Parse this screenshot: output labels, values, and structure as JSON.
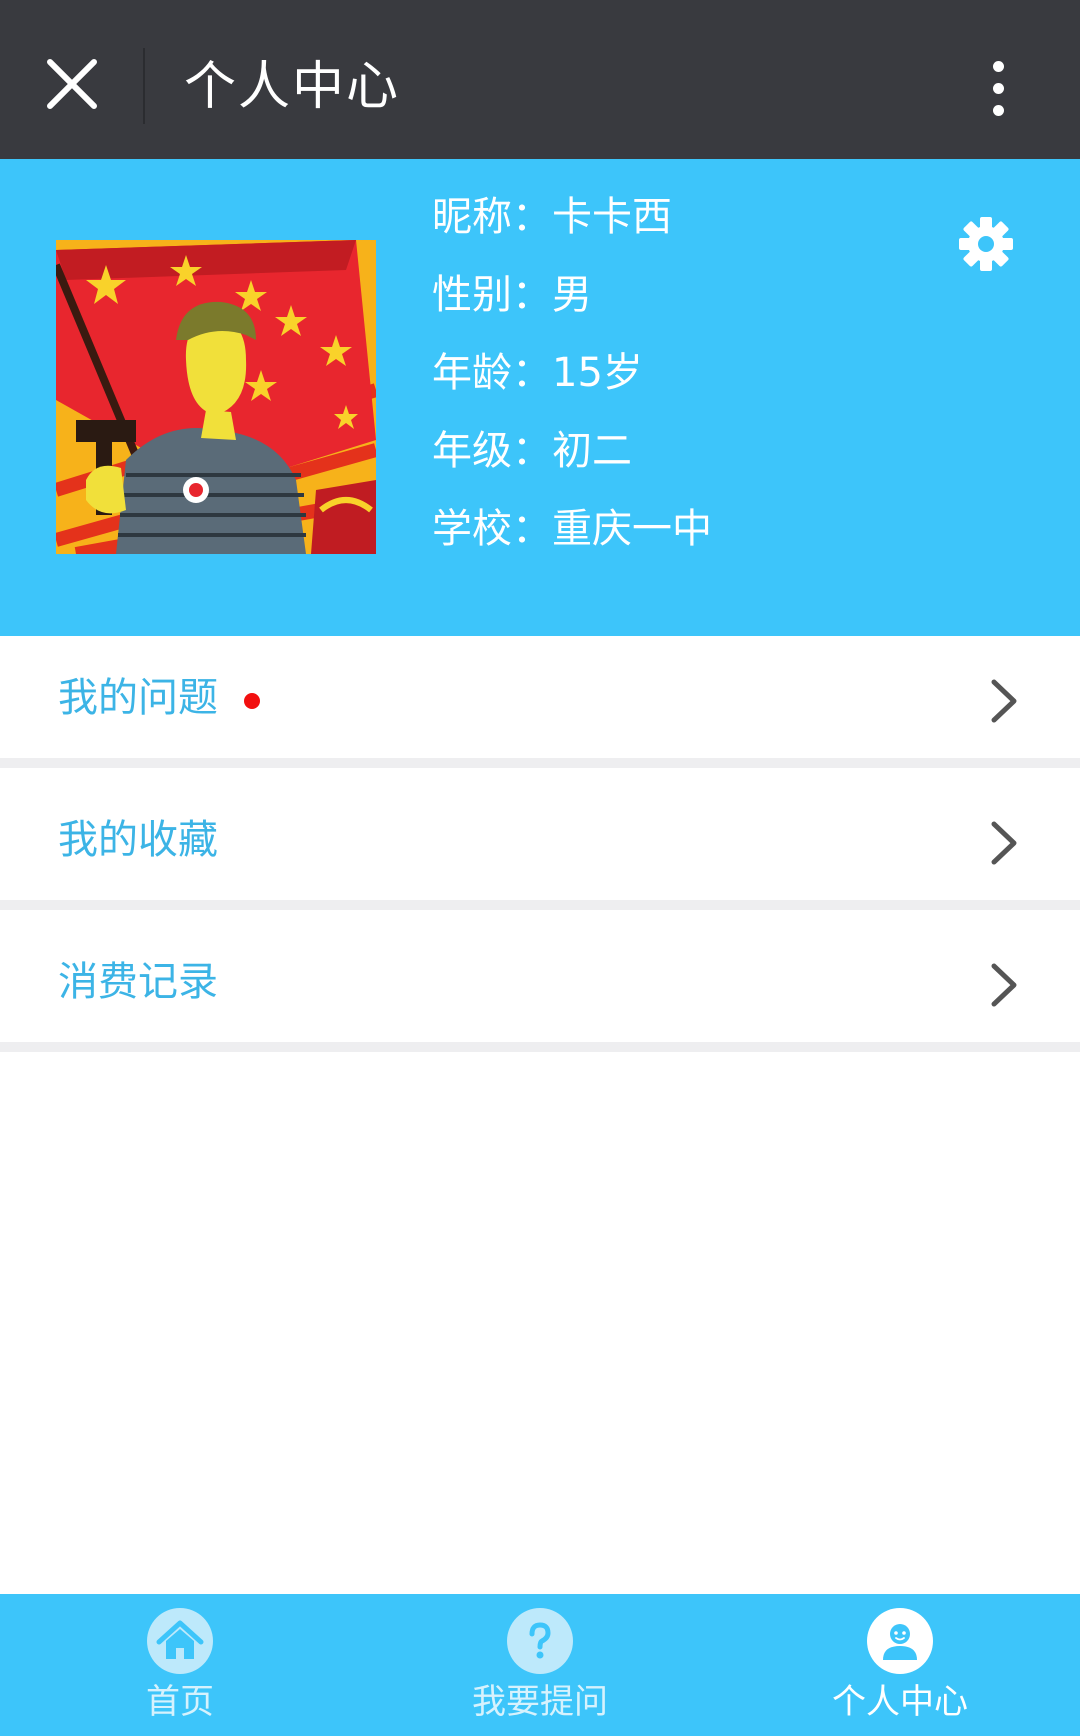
{
  "topbar": {
    "title": "个人中心",
    "close_icon": "close-icon",
    "more_icon": "more-vertical-icon"
  },
  "profile": {
    "avatar_icon": "avatar-image",
    "settings_icon": "gear-icon",
    "fields": [
      {
        "label": "昵称：",
        "value": "卡卡西"
      },
      {
        "label": "性别：",
        "value": "男"
      },
      {
        "label": "年龄：",
        "value": "15岁"
      },
      {
        "label": "年级：",
        "value": "初二"
      },
      {
        "label": "学校：",
        "value": "重庆一中"
      }
    ]
  },
  "menu": [
    {
      "label": "我的问题",
      "has_badge": true
    },
    {
      "label": "我的收藏",
      "has_badge": false
    },
    {
      "label": "消费记录",
      "has_badge": false
    }
  ],
  "tabs": [
    {
      "label": "首页",
      "icon": "home-icon",
      "active": false
    },
    {
      "label": "我要提问",
      "icon": "question-icon",
      "active": false
    },
    {
      "label": "个人中心",
      "icon": "user-icon",
      "active": true
    }
  ],
  "colors": {
    "topbar": "#393a3f",
    "accent": "#3dc5fa",
    "menu_text": "#3cb4e6",
    "badge": "#f20f0f"
  }
}
